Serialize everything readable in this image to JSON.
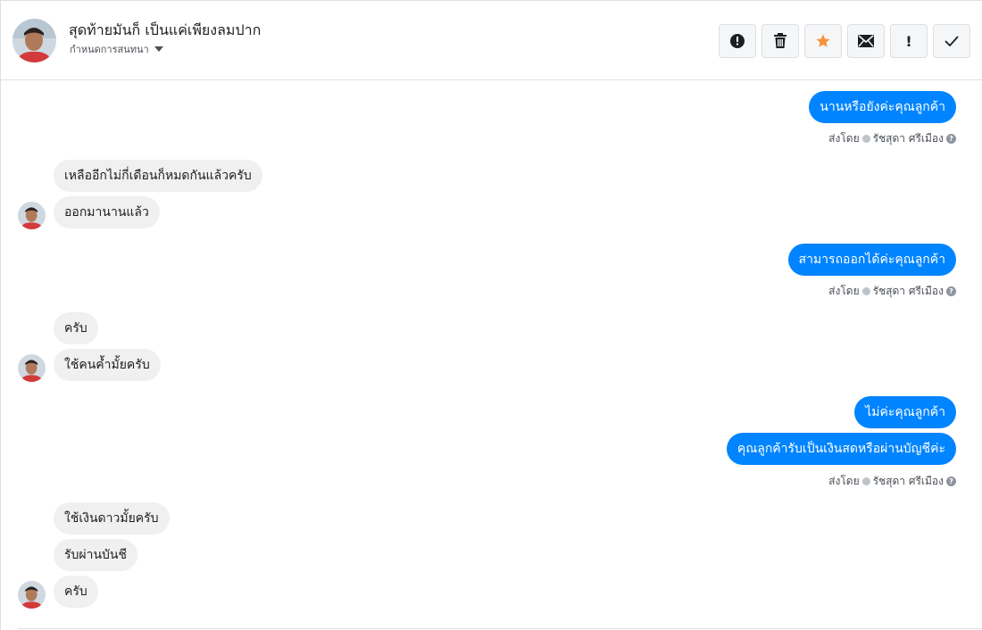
{
  "header": {
    "contact_name": "สุดท้ายมันก็ เป็นแค่เพียงลมปาก",
    "assign_label": "กำหนดการสนทนา"
  },
  "toolbar": {
    "icons": [
      "alert-circle-icon",
      "trash-icon",
      "star-icon",
      "envelope-icon",
      "exclamation-icon",
      "check-icon"
    ],
    "exclamation_glyph": "!",
    "star_color": "#f7923b"
  },
  "messages": {
    "m1": "นานหรือยังค่ะคุณลูกค้า",
    "m2": "เหลืออีกไม่กี่เดือนก็หมดกันแล้วครับ",
    "m3": "ออกมานานแล้ว",
    "m4": "สามารถออกได้ค่ะคุณลูกค้า",
    "m5": "ครับ",
    "m6": "ใช้คนค้ำมั้ยครับ",
    "m7": "ไม่ค่ะคุณลูกค้า",
    "m8": "คุณลูกค้ารับเป็นเงินสดหรือผ่านบัญชีค่ะ",
    "m9": "ใช้เงินดาวมั้ยครับ",
    "m10": "รับผ่านบันชี",
    "m11": "ครับ"
  },
  "sent_by": {
    "prefix": "ส่งโดย",
    "agent": "รัชสุดา ศรีเมือง",
    "help": "?"
  },
  "colors": {
    "outgoing": "#0084ff",
    "incoming": "#f1f0f0"
  }
}
